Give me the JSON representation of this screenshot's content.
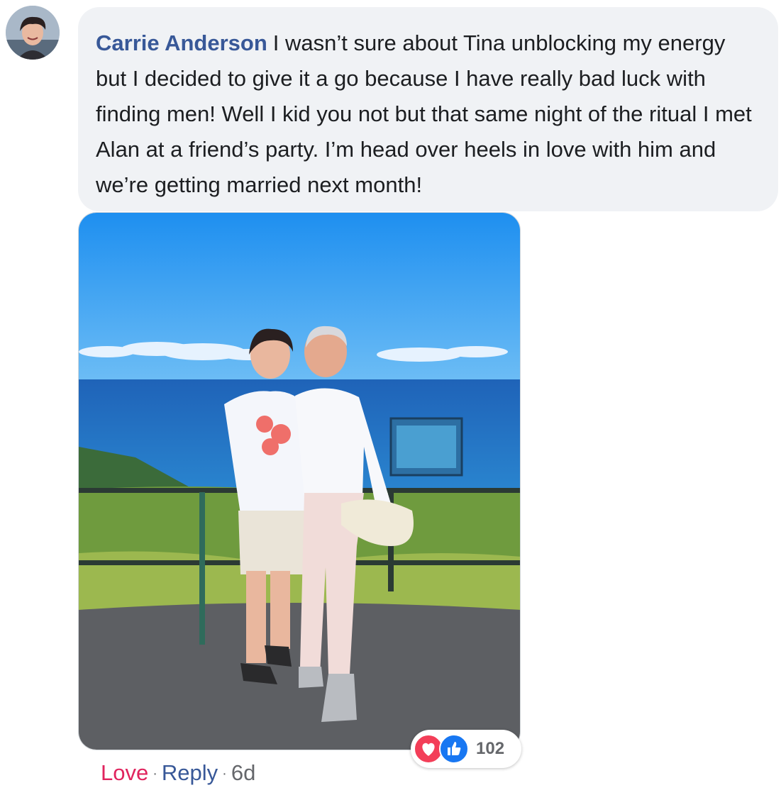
{
  "comment": {
    "author": "Carrie Anderson",
    "text": "I wasn’t sure about Tina unblocking my energy but I decided to give it a go because I have really bad luck with finding men! Well I kid you not but that same night of the ritual I met Alan at a friend’s party. I’m head over heels in love with him and we’re getting married next month!",
    "avatar_icon": "profile-photo",
    "photo_description_icon": "photo-couple-ocean-lookout"
  },
  "reactions": {
    "icons": [
      "heart-icon",
      "thumbs-up-icon"
    ],
    "count": "102",
    "colors": {
      "love": "#f33e58",
      "like": "#1877f2"
    }
  },
  "actions": {
    "love": "Love",
    "separator": "·",
    "reply": "Reply",
    "time": "6d",
    "colors": {
      "love": "#e0245e",
      "reply": "#385898",
      "muted": "#65676b"
    }
  },
  "theme": {
    "bubble_bg": "#f0f2f5",
    "author_color": "#385898",
    "text_color": "#1c1e21"
  }
}
